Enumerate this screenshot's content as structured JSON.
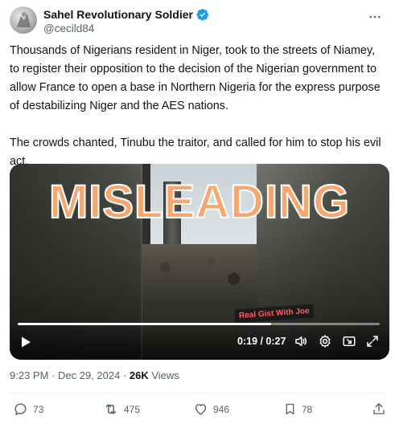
{
  "author": {
    "display_name": "Sahel Revolutionary Soldier",
    "handle": "@cecild84"
  },
  "tweet": {
    "text": "Thousands of Nigerians resident in Niger, took to the streets of Niamey, to register their opposition to the decision of the Nigerian government to allow France to open a base in Northern Nigeria for the express purpose of destabilizing Niger and the AES nations.\n\nThe crowds chanted, Tinubu the traitor, and called for him to stop his evil act."
  },
  "media": {
    "overlay_label": "MISLEADING",
    "watermark": "Real Gist With Joe",
    "time_display": "0:19 / 0:27",
    "progress": 0.7
  },
  "meta": {
    "time": "9:23 PM",
    "separator": " · ",
    "date": "Dec 29, 2024",
    "views_count": "26K",
    "views_label": " Views"
  },
  "actions": {
    "replies": "73",
    "reposts": "475",
    "likes": "946",
    "bookmarks": "78"
  },
  "colors": {
    "text_primary": "#0f1419",
    "text_secondary": "#536471",
    "verified": "#1d9bf0",
    "overlay_text": "#f7a66e"
  },
  "icons": [
    "verified-badge-icon",
    "more-icon",
    "play-icon",
    "volume-icon",
    "settings-icon",
    "pip-icon",
    "fullscreen-icon",
    "reply-icon",
    "repost-icon",
    "like-icon",
    "bookmark-icon",
    "share-icon"
  ]
}
